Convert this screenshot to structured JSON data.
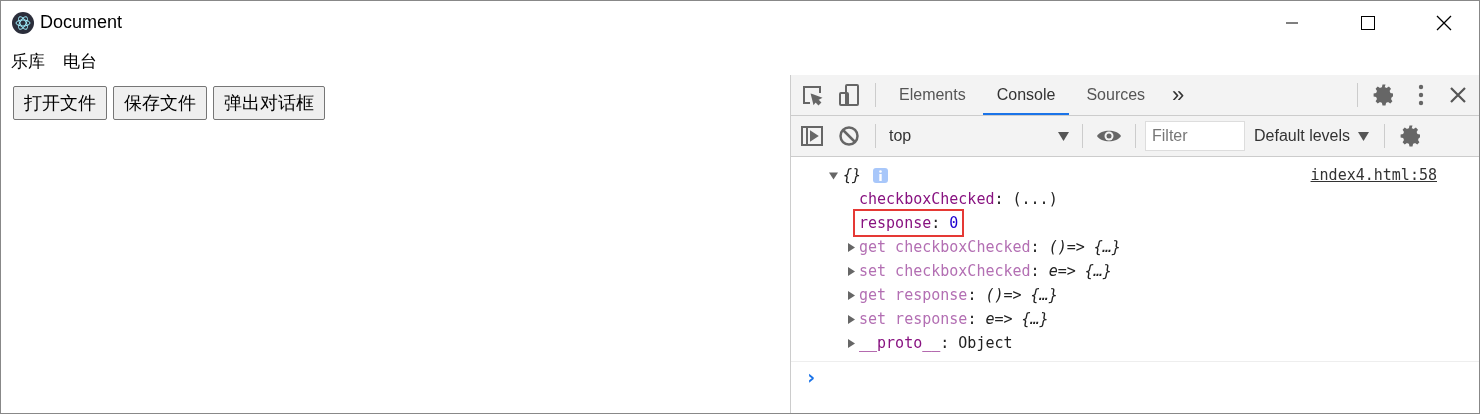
{
  "window": {
    "title": "Document"
  },
  "nav": [
    {
      "label": "乐库"
    },
    {
      "label": "电台"
    }
  ],
  "buttons": [
    {
      "label": "打开文件"
    },
    {
      "label": "保存文件"
    },
    {
      "label": "弹出对话框"
    }
  ],
  "devtools": {
    "tabs": [
      {
        "label": "Elements",
        "selected": false
      },
      {
        "label": "Console",
        "selected": true
      },
      {
        "label": "Sources",
        "selected": false
      }
    ],
    "more_tabs": "»",
    "context": "top",
    "filter": {
      "placeholder": "Filter"
    },
    "levels": "Default levels",
    "console": {
      "object": {
        "label": "{}",
        "expanded": true,
        "source": "index4.html:58",
        "properties": [
          {
            "kind": "lazy",
            "key": "checkboxChecked",
            "separator": ":",
            "value": "(...)",
            "highlighted": false
          },
          {
            "kind": "primitive",
            "key": "response",
            "separator": ":",
            "value": "0",
            "highlighted": true
          },
          {
            "kind": "accessor",
            "key": "get checkboxChecked",
            "separator": ":",
            "value": "()=> {…}",
            "highlighted": false,
            "expanded": false
          },
          {
            "kind": "accessor",
            "key": "set checkboxChecked",
            "separator": ":",
            "value": "e=> {…}",
            "highlighted": false,
            "expanded": false
          },
          {
            "kind": "accessor",
            "key": "get response",
            "separator": ":",
            "value": "()=> {…}",
            "highlighted": false,
            "expanded": false
          },
          {
            "kind": "accessor",
            "key": "set response",
            "separator": ":",
            "value": "e=> {…}",
            "highlighted": false,
            "expanded": false
          },
          {
            "kind": "internal",
            "key": "__proto__",
            "separator": ":",
            "value": "Object",
            "highlighted": false,
            "expanded": false
          }
        ]
      },
      "prompt": "›"
    }
  }
}
